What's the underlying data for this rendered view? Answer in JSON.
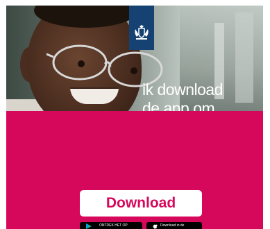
{
  "ad": {
    "headline_line1": "ik download",
    "headline_line2": "de app om",
    "cta_label": "Download",
    "brand_color": "#d6085c",
    "logo_color": "#154273"
  },
  "badges": {
    "google_play_label": "ONTDEK HET OP",
    "app_store_label": "Download in de"
  },
  "icons": {
    "logo": "rijksoverheid-coat-of-arms-icon",
    "google_play": "google-play-icon",
    "apple": "apple-icon"
  }
}
